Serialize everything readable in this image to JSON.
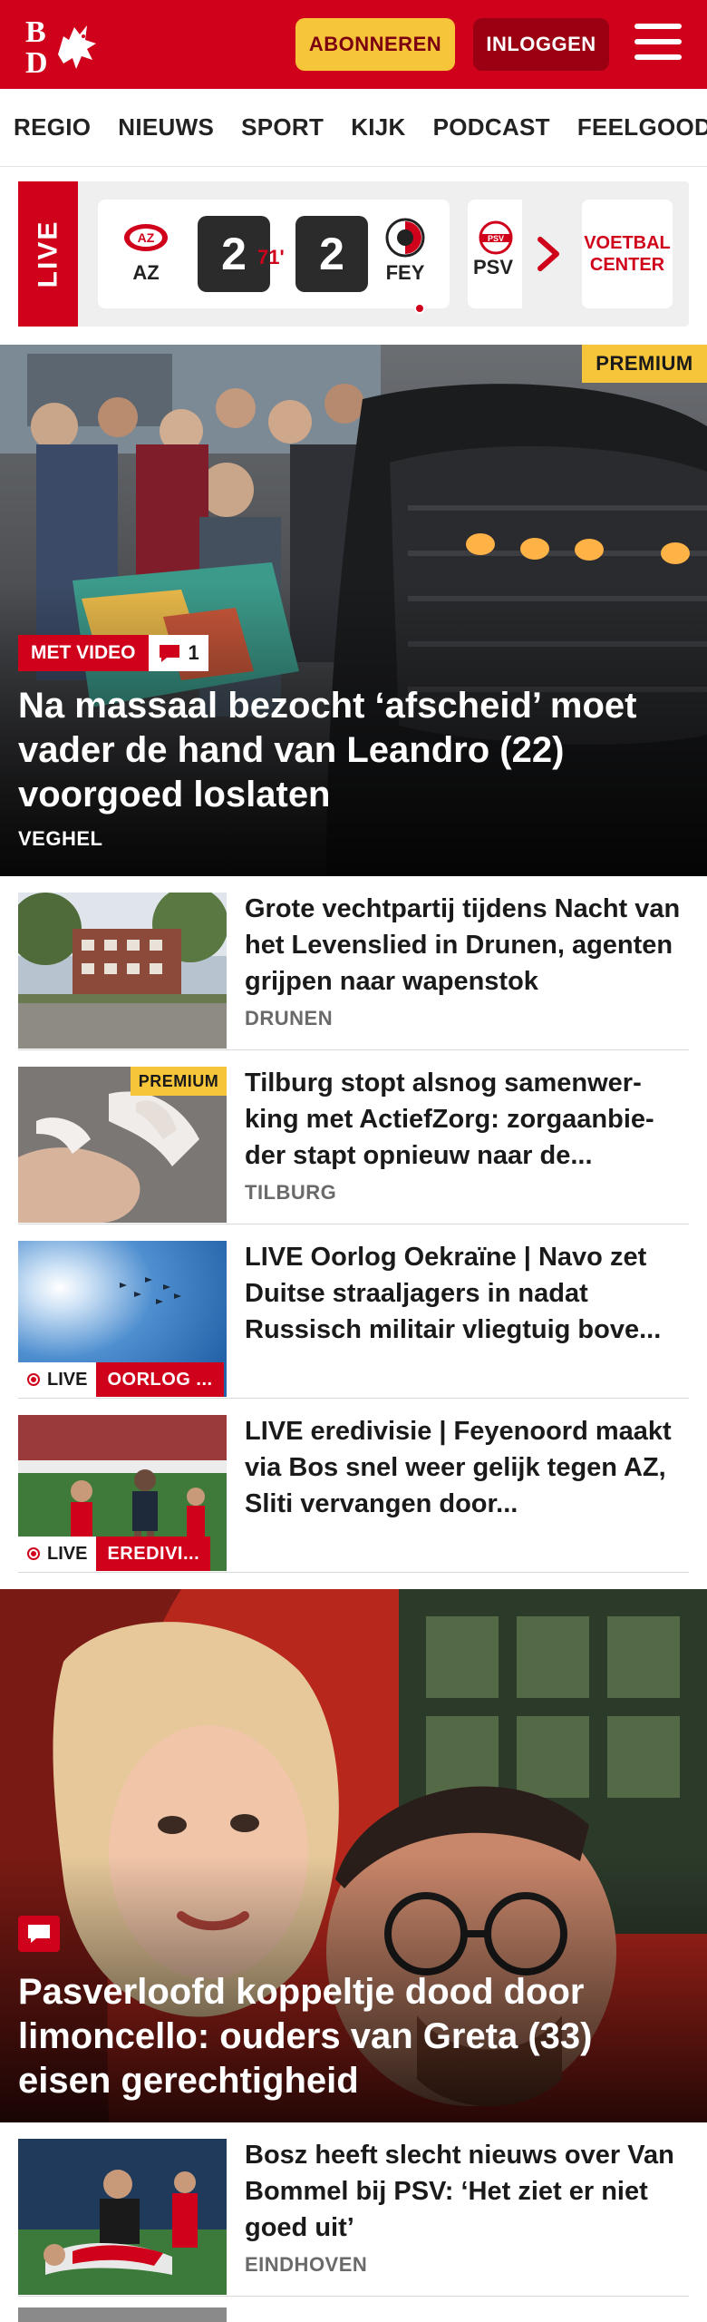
{
  "header": {
    "logo_text": "BD",
    "subscribe_label": "ABONNEREN",
    "login_label": "INLOGGEN",
    "brand_color": "#d0021b"
  },
  "nav": {
    "items": [
      "REGIO",
      "NIEUWS",
      "SPORT",
      "KIJK",
      "PODCAST",
      "FEELGOOD"
    ]
  },
  "live": {
    "badge": "LIVE",
    "match": {
      "home": "AZ",
      "away": "FEY",
      "home_score": "2",
      "away_score": "2",
      "minute": "71'"
    },
    "next_team": "PSV",
    "center_label": "VOETBAL CENTER"
  },
  "hero": {
    "premium": "PREMIUM",
    "video_tag": "MET VIDEO",
    "comments": "1",
    "title": "Na massaal bezocht ‘afscheid’ moet vader de hand van Leandro (22) voorgoed loslaten",
    "location": "VEGHEL"
  },
  "articles": [
    {
      "title": "Grote vechtpartij tijdens Nacht van het Levenslied in Drunen, agenten grijpen naar wapenstok",
      "location": "DRUNEN"
    },
    {
      "premium": "PREMIUM",
      "title": "Tilburg stopt alsnog samenwer­king met ActiefZorg: zorgaanbie­der stapt opnieuw naar de...",
      "location": "TILBURG"
    },
    {
      "live": "LIVE",
      "category": "OORLOG ...",
      "title": "LIVE Oorlog Oekraïne | Navo zet Duitse straaljagers in nadat Russisch militair vliegtuig bove..."
    },
    {
      "live": "LIVE",
      "category": "EREDIVI...",
      "title": "LIVE eredivisie | Feyenoord maakt via Bos snel weer gelijk tegen AZ, Sliti vervangen door..."
    }
  ],
  "hero2": {
    "title": "Pasverloofd koppeltje dood door limoncello: ouders van Greta (33) eisen gerechtigheid"
  },
  "articles2": [
    {
      "title": "Bosz heeft slecht nieuws over Van Bommel bij PSV: ‘Het ziet er niet goed uit’",
      "location": "EINDHOVEN"
    }
  ]
}
